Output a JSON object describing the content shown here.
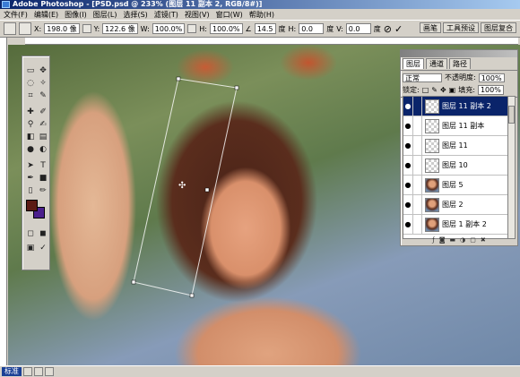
{
  "window": {
    "title": "Adobe Photoshop - [PSD.psd @ 233% (图层 11 副本 2, RGB/8#)]"
  },
  "menu": {
    "items": [
      "文件(F)",
      "编辑(E)",
      "图像(I)",
      "图层(L)",
      "选择(S)",
      "滤镜(T)",
      "视图(V)",
      "窗口(W)",
      "帮助(H)"
    ]
  },
  "options": {
    "x_label": "X:",
    "x_value": "198.0 像",
    "y_label": "Y:",
    "y_value": "122.6 像",
    "w_label": "W:",
    "w_value": "100.0%",
    "h_label": "H:",
    "h_value": "100.0%",
    "angle_value": "14.5",
    "angle_unit": "度",
    "hskew_label": "H:",
    "hskew_value": "0.0",
    "hskew_unit": "度",
    "vskew_label": "V:",
    "vskew_value": "0.0",
    "vskew_unit": "度"
  },
  "palette_tabs": [
    "画笔",
    "工具预设",
    "图层复合"
  ],
  "layers": {
    "tabs": [
      "图层",
      "通道",
      "路径"
    ],
    "blend_mode": "正常",
    "opacity_label": "不透明度:",
    "opacity_value": "100%",
    "lock_label": "锁定:",
    "fill_label": "填充:",
    "fill_value": "100%",
    "items": [
      {
        "name": "图层 11 副本 2",
        "active": true,
        "thumb": "checker"
      },
      {
        "name": "图层 11 副本",
        "active": false,
        "thumb": "checker"
      },
      {
        "name": "图层 11",
        "active": false,
        "thumb": "checker"
      },
      {
        "name": "图层 10",
        "active": false,
        "thumb": "checker"
      },
      {
        "name": "图层 5",
        "active": false,
        "thumb": "photo"
      },
      {
        "name": "图层 2",
        "active": false,
        "thumb": "photo"
      },
      {
        "name": "图层 1 副本 2",
        "active": false,
        "thumb": "photo"
      },
      {
        "name": "图层 1 副本",
        "active": false,
        "thumb": "photo"
      }
    ]
  },
  "status": {
    "task_label": "标准"
  },
  "colors": {
    "foreground": "#5b1a14",
    "background": "#4b1f8c",
    "accent": "#0a246a"
  }
}
